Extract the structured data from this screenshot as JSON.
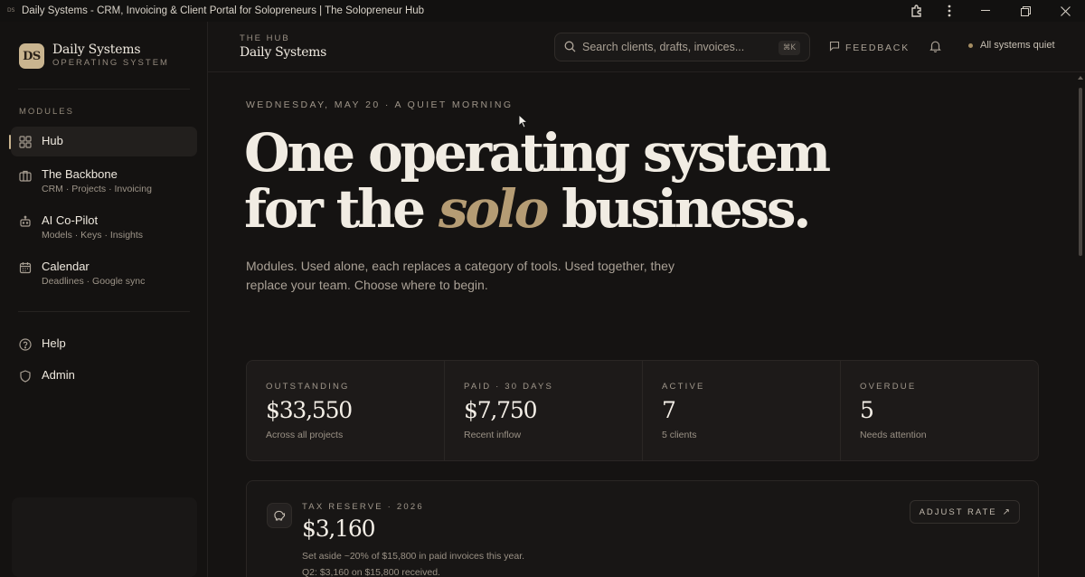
{
  "window": {
    "favicon": "DS",
    "title": "Daily Systems - CRM, Invoicing & Client Portal for Solopreneurs | The Solopreneur Hub"
  },
  "sidebar": {
    "brand": {
      "logo": "DS",
      "name": "Daily Systems",
      "subtitle": "OPERATING SYSTEM"
    },
    "modules_label": "MODULES",
    "items": [
      {
        "label": "Hub",
        "sub": "",
        "icon": "grid-icon",
        "active": true
      },
      {
        "label": "The Backbone",
        "sub": "CRM · Projects · Invoicing",
        "icon": "briefcase-icon"
      },
      {
        "label": "AI Co-Pilot",
        "sub": "Models · Keys · Insights",
        "icon": "bot-icon"
      },
      {
        "label": "Calendar",
        "sub": "Deadlines · Google sync",
        "icon": "calendar-icon"
      }
    ],
    "footer_items": [
      {
        "label": "Help",
        "icon": "help-circle-icon"
      },
      {
        "label": "Admin",
        "icon": "shield-icon"
      }
    ]
  },
  "header": {
    "eyebrow": "THE HUB",
    "title": "Daily Systems",
    "search": {
      "placeholder": "Search clients, drafts, invoices...",
      "shortcut": "⌘K"
    },
    "feedback_label": "FEEDBACK",
    "status_text": "All systems quiet"
  },
  "main": {
    "date_line": "WEDNESDAY, MAY 20 · A QUIET MORNING",
    "hero": {
      "line1": "One operating system",
      "line2_before": "for the",
      "line2_accent": "solo",
      "line2_after": "business."
    },
    "lead": "Modules. Used alone, each replaces a category of tools. Used together, they replace your team. Choose where to begin.",
    "stats": [
      {
        "label": "OUTSTANDING",
        "value": "$33,550",
        "sub": "Across all projects"
      },
      {
        "label": "PAID · 30 DAYS",
        "value": "$7,750",
        "sub": "Recent inflow"
      },
      {
        "label": "ACTIVE",
        "value": "7",
        "sub": "5 clients"
      },
      {
        "label": "OVERDUE",
        "value": "5",
        "sub": "Needs attention"
      }
    ],
    "tax": {
      "label": "TAX RESERVE · 2026",
      "value": "$3,160",
      "line1": "Set aside ~20% of $15,800 in paid invoices this year.",
      "line2": "Q2: $3,160 on $15,800 received.",
      "button": "ADJUST RATE",
      "button_arrow": "↗"
    }
  },
  "colors": {
    "accent": "#b59c74",
    "background": "#151312",
    "surface": "#1d1a19",
    "text": "#f1ece3"
  }
}
